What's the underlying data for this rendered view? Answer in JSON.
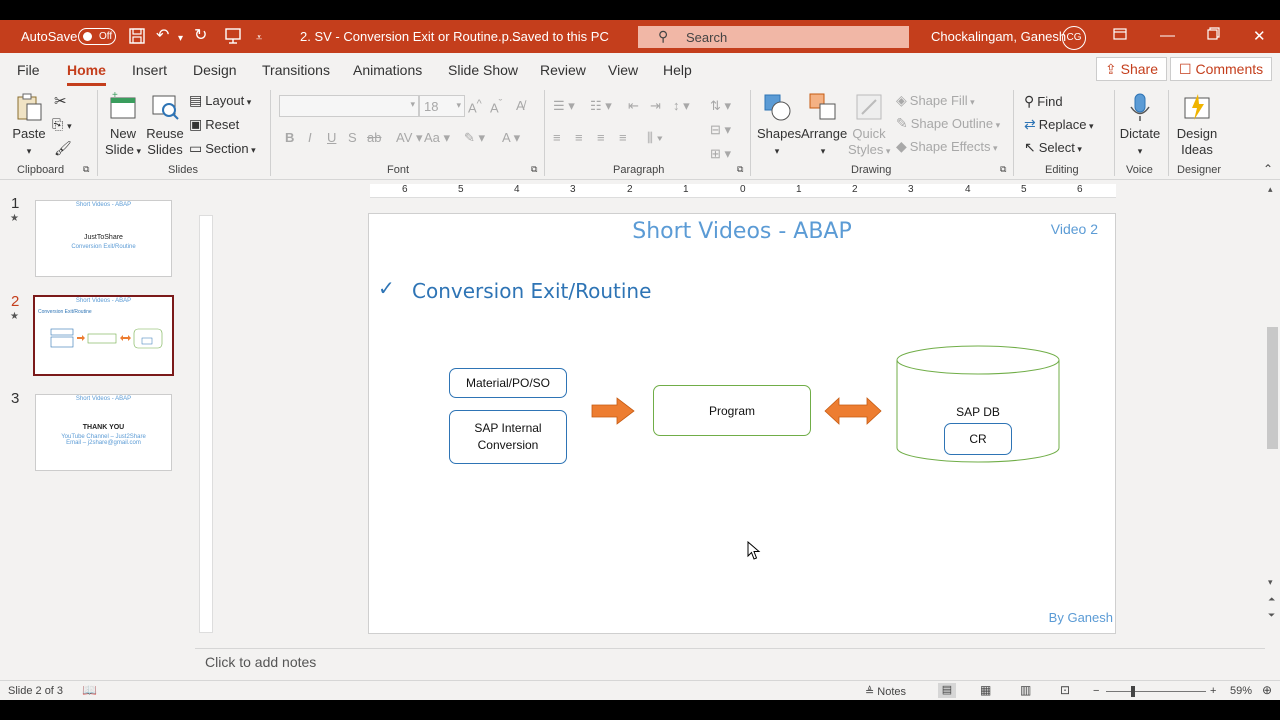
{
  "titlebar": {
    "autosave_label": "AutoSave",
    "autosave_state": "Off",
    "document_title": "2. SV - Conversion Exit or Routine.p...",
    "save_status": "Saved to this PC",
    "search_placeholder": "Search",
    "user_name": "Chockalingam, Ganesh",
    "user_initials": "CG",
    "color": "#c43e1c"
  },
  "tabs": [
    "File",
    "Home",
    "Insert",
    "Design",
    "Transitions",
    "Animations",
    "Slide Show",
    "Review",
    "View",
    "Help"
  ],
  "active_tab": "Home",
  "share_label": "Share",
  "comments_label": "Comments",
  "ribbon": {
    "clipboard": {
      "paste": "Paste",
      "group": "Clipboard"
    },
    "slides": {
      "new_slide_1": "New",
      "new_slide_2": "Slide",
      "reuse_1": "Reuse",
      "reuse_2": "Slides",
      "layout": "Layout",
      "reset": "Reset",
      "section": "Section",
      "group": "Slides"
    },
    "font": {
      "size": "18",
      "group": "Font"
    },
    "paragraph": {
      "group": "Paragraph"
    },
    "drawing": {
      "shapes": "Shapes",
      "arrange": "Arrange",
      "quick_1": "Quick",
      "quick_2": "Styles",
      "shape_fill": "Shape Fill",
      "shape_outline": "Shape Outline",
      "shape_effects": "Shape Effects",
      "group": "Drawing"
    },
    "editing": {
      "find": "Find",
      "replace": "Replace",
      "select": "Select",
      "group": "Editing"
    },
    "voice": {
      "dictate": "Dictate",
      "group": "Voice"
    },
    "designer": {
      "ideas_1": "Design",
      "ideas_2": "Ideas",
      "group": "Designer"
    }
  },
  "thumbnails": [
    {
      "number": "1",
      "header": "Short Videos - ABAP",
      "title": "JustToShare",
      "subtitle": "Conversion Exit/Routine"
    },
    {
      "number": "2",
      "header": "Short Videos - ABAP",
      "title": "Conversion Exit/Routine",
      "subtitle": ""
    },
    {
      "number": "3",
      "header": "Short Videos - ABAP",
      "title": "THANK YOU",
      "subtitle": "YouTube Channel – Just2Share",
      "subtitle2": "Email – j2share@gmail.com"
    }
  ],
  "ruler": {
    "h_ticks": [
      "6",
      "5",
      "4",
      "3",
      "2",
      "1",
      "0",
      "1",
      "2",
      "3",
      "4",
      "5",
      "6"
    ]
  },
  "slide": {
    "title": "Short Videos - ABAP",
    "video_label": "Video 2",
    "check": "✓",
    "heading": "Conversion Exit/Routine",
    "box_material": "Material/PO/SO",
    "box_sap_internal_1": "SAP Internal",
    "box_sap_internal_2": "Conversion",
    "box_program": "Program",
    "db_label": "SAP DB",
    "db_inner": "CR",
    "footer": "By Ganesh",
    "accent": "#5b9bd5",
    "arrow_color": "#ed7d31"
  },
  "notes_placeholder": "Click to add notes",
  "status": {
    "slide_info": "Slide 2 of 3",
    "notes": "Notes",
    "zoom": "59%"
  }
}
